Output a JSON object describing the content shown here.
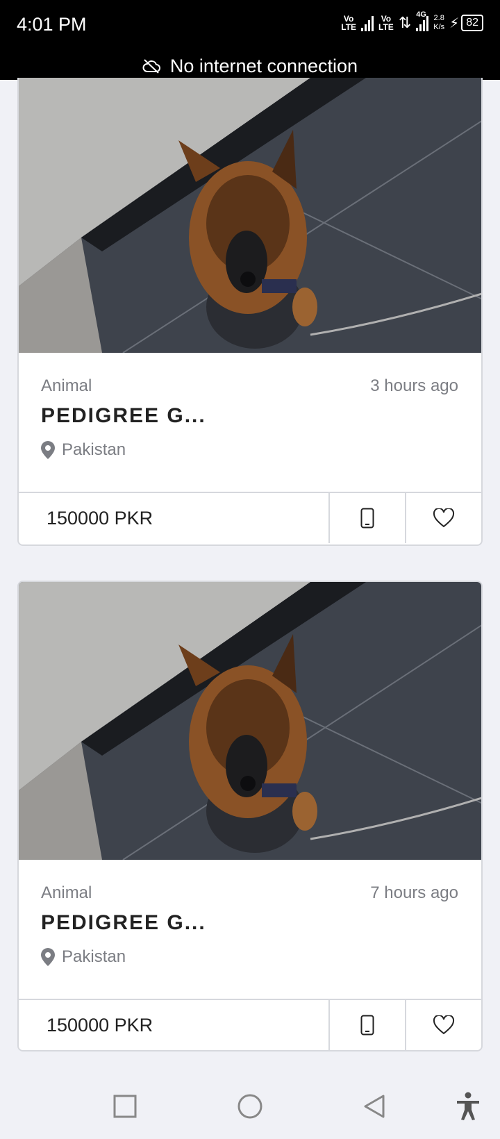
{
  "status_bar": {
    "time": "4:01 PM",
    "sim1_label_top": "Vo",
    "sim1_label_bottom": "LTE",
    "sim2_label_top": "Vo",
    "sim2_label_bottom": "LTE",
    "network_type": "4G",
    "speed_value": "2.8",
    "speed_unit": "K/s",
    "battery": "82"
  },
  "banner": {
    "text": "No internet connection",
    "icon": "cloud-off-icon"
  },
  "listings": [
    {
      "category": "Animal",
      "time_ago": "3 hours ago",
      "title": "PEDIGREE G...",
      "location": "Pakistan",
      "price": "150000 PKR"
    },
    {
      "category": "Animal",
      "time_ago": "7 hours ago",
      "title": "PEDIGREE G...",
      "location": "Pakistan",
      "price": "150000 PKR"
    }
  ],
  "nav": {
    "recents_icon": "square-icon",
    "home_icon": "circle-icon",
    "back_icon": "triangle-back-icon",
    "accessibility_icon": "accessibility-icon"
  },
  "colors": {
    "background": "#f0f1f6",
    "card_border": "#d6d8dd",
    "muted_text": "#7b7d83",
    "title_text": "#222222"
  }
}
